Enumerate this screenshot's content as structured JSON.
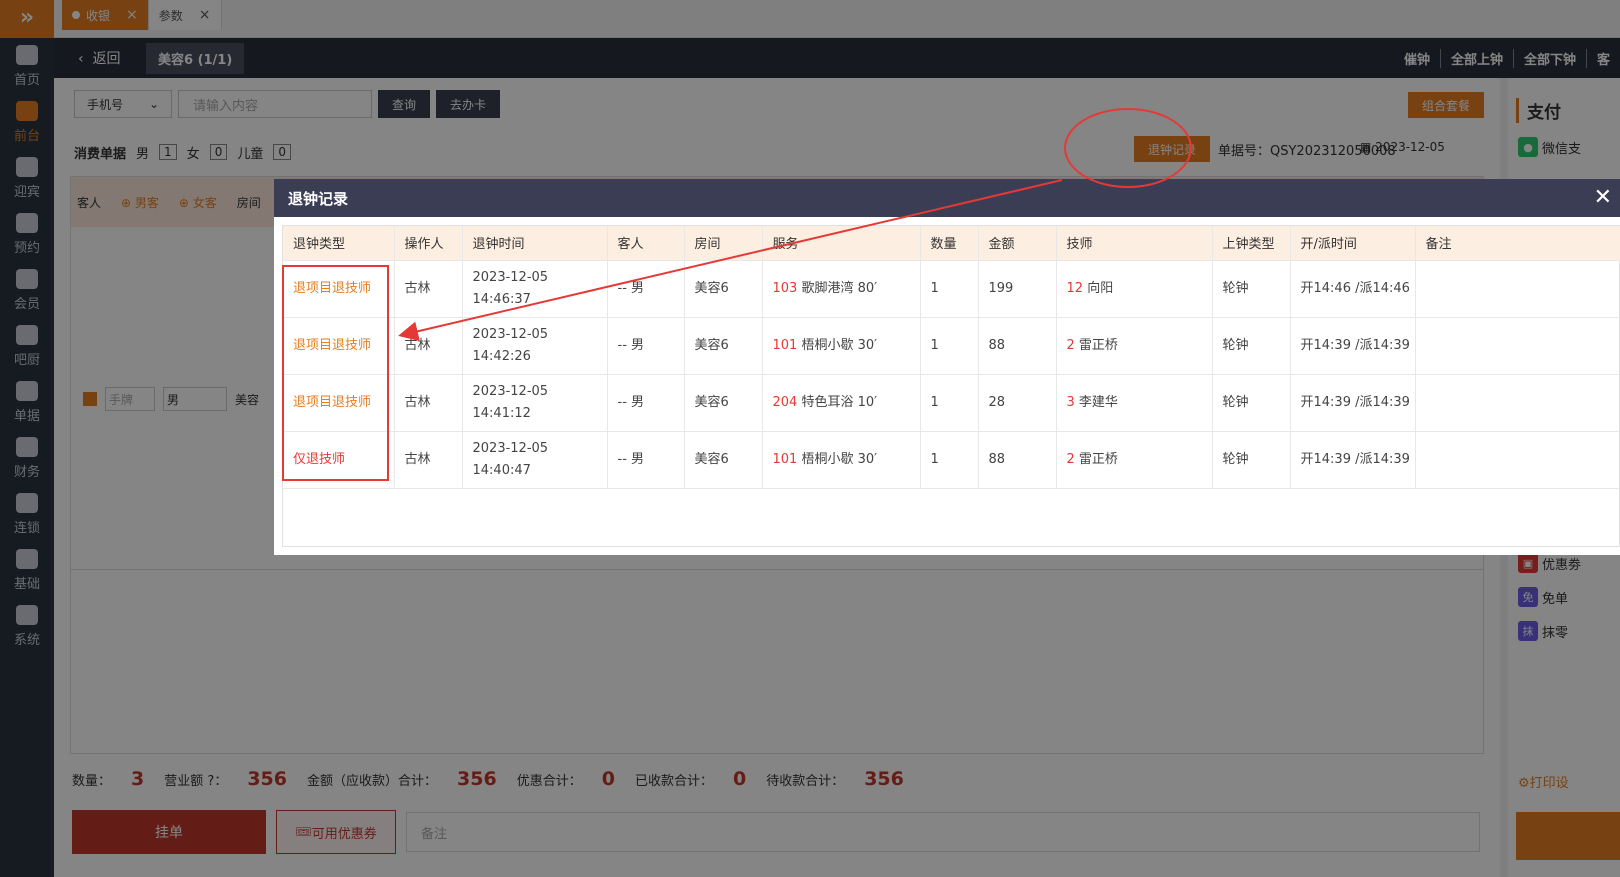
{
  "tabs": [
    {
      "label": "收银",
      "active": true
    },
    {
      "label": "参数",
      "active": false
    }
  ],
  "sidebar": {
    "items": [
      {
        "label": "首页",
        "icon": "home-icon"
      },
      {
        "label": "前台",
        "icon": "monitor-icon",
        "active": true
      },
      {
        "label": "迎宾",
        "icon": "reception-icon"
      },
      {
        "label": "预约",
        "icon": "calendar-icon"
      },
      {
        "label": "会员",
        "icon": "user-icon"
      },
      {
        "label": "吧厨",
        "icon": "cup-icon"
      },
      {
        "label": "单据",
        "icon": "document-icon"
      },
      {
        "label": "财务",
        "icon": "wallet-icon"
      },
      {
        "label": "连锁",
        "icon": "cube-icon"
      },
      {
        "label": "基础",
        "icon": "sliders-icon"
      },
      {
        "label": "系统",
        "icon": "gear-icon"
      }
    ]
  },
  "header": {
    "back_label": "返回",
    "room_chip": "美容6 (1/1)",
    "actions": [
      "催钟",
      "全部上钟",
      "全部下钟",
      "客"
    ]
  },
  "search": {
    "type_value": "手机号",
    "placeholder": "请输入内容",
    "query_label": "查询",
    "card_label": "去办卡",
    "combo_label": "组合套餐"
  },
  "bill": {
    "title": "消费单据",
    "male_label": "男",
    "male_count": "1",
    "female_label": "女",
    "female_count": "0",
    "child_label": "儿童",
    "child_count": "0",
    "refund_record_label": "退钟记录",
    "bill_no": "单据号：QSY202312050008",
    "date": "2023-12-05"
  },
  "grid": {
    "guest_col": "客人",
    "add_male": "男客",
    "add_female": "女客",
    "room_col": "房间",
    "hand_placeholder": "手牌",
    "gender_value": "男",
    "room_value": "美容"
  },
  "totals": {
    "qty_label": "数量：",
    "qty": "3",
    "revenue_label": "营业额",
    "revenue": "356",
    "amount_label": "金额（应收款）合计：",
    "amount": "356",
    "discount_label": "优惠合计：",
    "discount": "0",
    "received_label": "已收款合计：",
    "received": "0",
    "pending_label": "待收款合计：",
    "pending": "356"
  },
  "footer": {
    "hang_label": "挂单",
    "coupon_label": "可用优惠券",
    "remark_placeholder": "备注"
  },
  "right_panel": {
    "title": "支付",
    "wechat": "微信支",
    "coupon": "优惠劵",
    "free": "免单",
    "erase": "抹零",
    "print": "打印设"
  },
  "modal": {
    "title": "退钟记录",
    "columns": [
      "退钟类型",
      "操作人",
      "退钟时间",
      "客人",
      "房间",
      "服务",
      "数量",
      "金额",
      "技师",
      "上钟类型",
      "开/派时间",
      "备注"
    ],
    "rows": [
      {
        "type": "退项目退技师",
        "operator": "古林",
        "time": "2023-12-05 14:46:37",
        "guest": "-- 男",
        "room": "美容6",
        "svc_no": "103",
        "svc_name": "歌脚港湾 80′",
        "qty": "1",
        "amount": "199",
        "tech_no": "12",
        "tech_name": "向阳",
        "clock_type": "轮钟",
        "open_time": "开14:46 /派14:46",
        "note": ""
      },
      {
        "type": "退项目退技师",
        "operator": "古林",
        "time": "2023-12-05 14:42:26",
        "guest": "-- 男",
        "room": "美容6",
        "svc_no": "101",
        "svc_name": "梧桐小歇 30′",
        "qty": "1",
        "amount": "88",
        "tech_no": "2",
        "tech_name": "雷正桥",
        "clock_type": "轮钟",
        "open_time": "开14:39 /派14:39",
        "note": ""
      },
      {
        "type": "退项目退技师",
        "operator": "古林",
        "time": "2023-12-05 14:41:12",
        "guest": "-- 男",
        "room": "美容6",
        "svc_no": "204",
        "svc_name": "特色耳浴 10′",
        "qty": "1",
        "amount": "28",
        "tech_no": "3",
        "tech_name": "李建华",
        "clock_type": "轮钟",
        "open_time": "开14:39 /派14:39",
        "note": ""
      },
      {
        "type": "仅退技师",
        "operator": "古林",
        "time": "2023-12-05 14:40:47",
        "guest": "-- 男",
        "room": "美容6",
        "svc_no": "101",
        "svc_name": "梧桐小歇 30′",
        "qty": "1",
        "amount": "88",
        "tech_no": "2",
        "tech_name": "雷正桥",
        "clock_type": "轮钟",
        "open_time": "开14:39 /派14:39",
        "note": ""
      }
    ]
  },
  "colors": {
    "accent": "#e67e22",
    "danger": "#e53935",
    "modal_header": "#3b3d55"
  }
}
